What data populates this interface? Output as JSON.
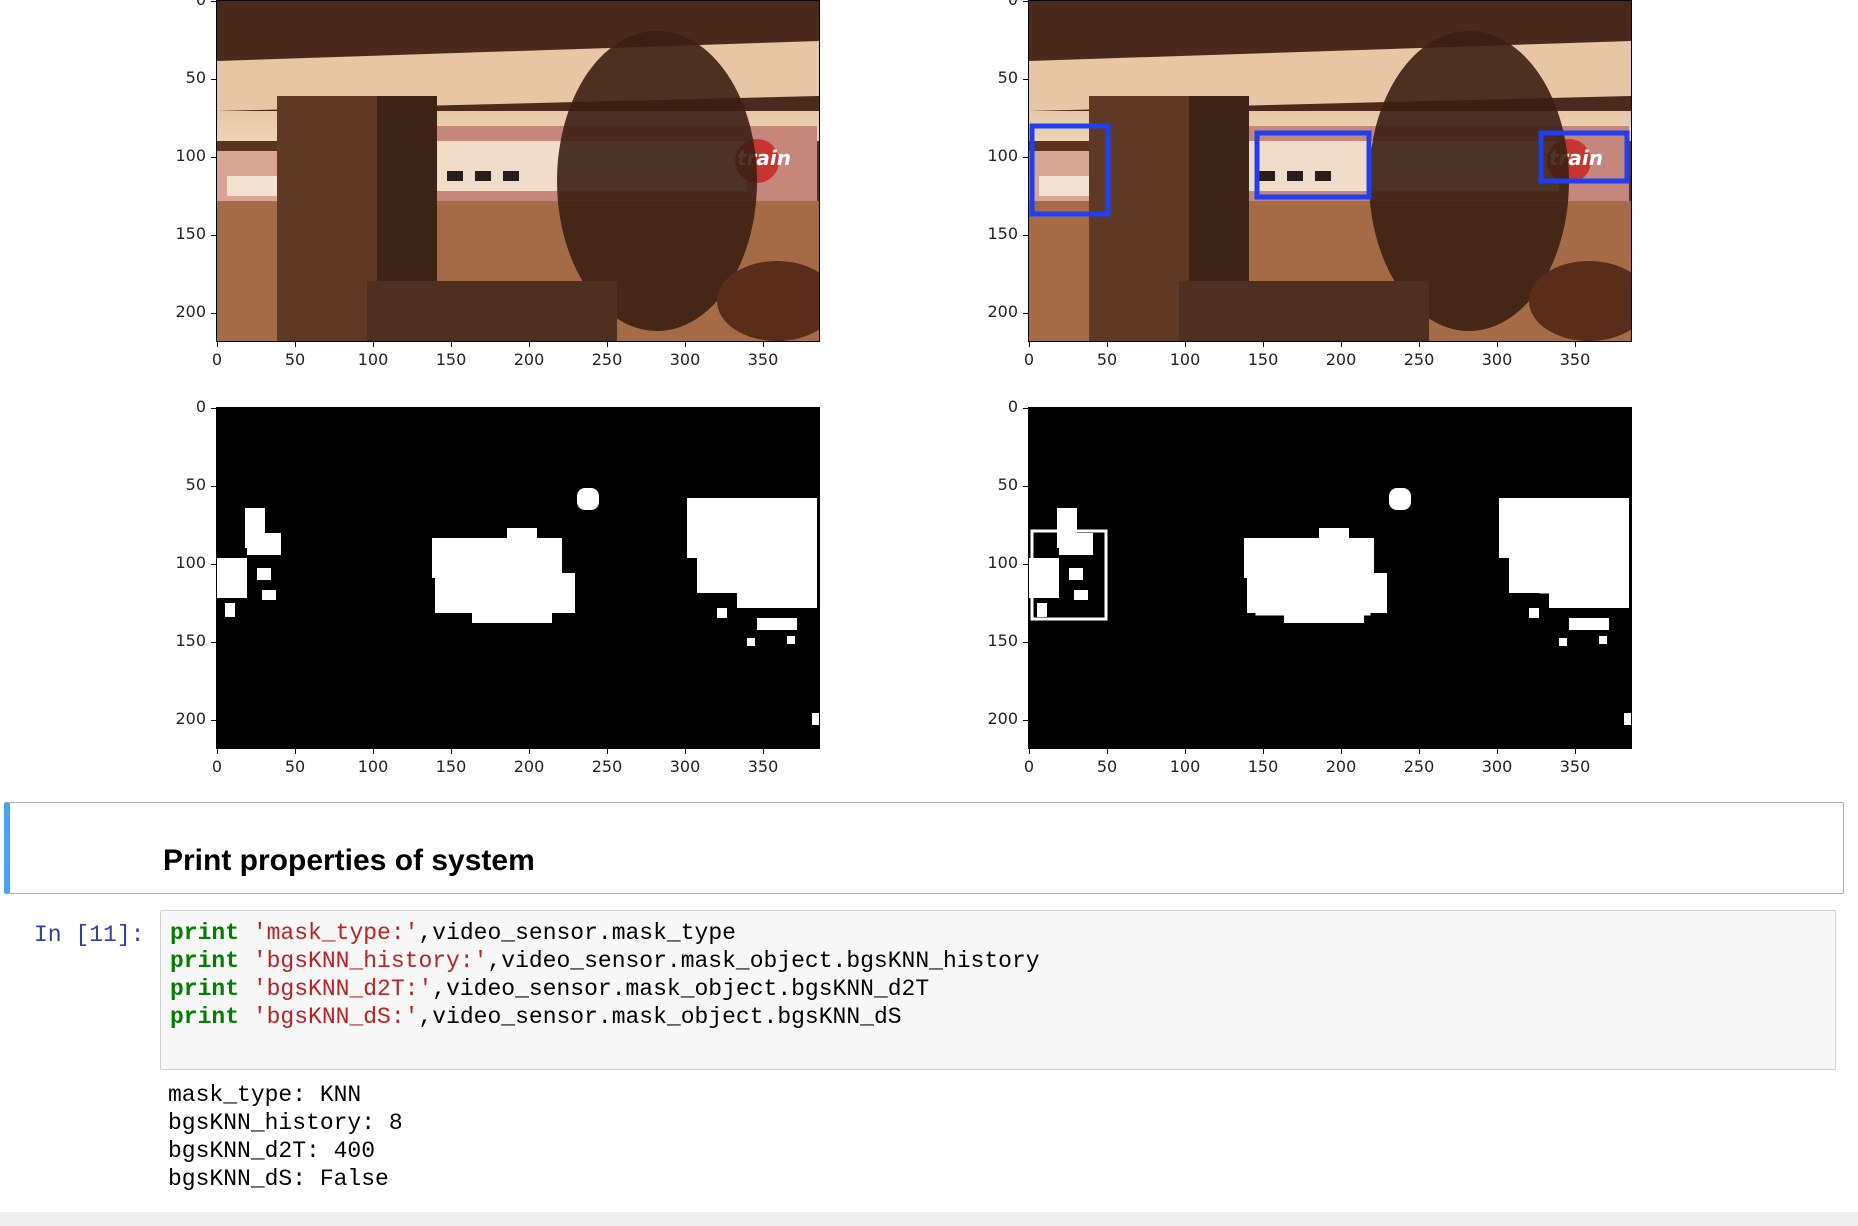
{
  "plots": {
    "y_ticks": [
      "0",
      "50",
      "100",
      "150",
      "200"
    ],
    "x_ticks": [
      "0",
      "50",
      "100",
      "150",
      "200",
      "250",
      "300",
      "350"
    ],
    "photo_text": "train"
  },
  "markdown": {
    "title": "Print properties of system"
  },
  "code_cell": {
    "prompt": "In [11]:",
    "lines": [
      {
        "kw": "print",
        "str": "'mask_type:'",
        "rest": ",video_sensor.mask_type"
      },
      {
        "kw": "print",
        "str": "'bgsKNN_history:'",
        "rest": ",video_sensor.mask_object.bgsKNN_history"
      },
      {
        "kw": "print",
        "str": "'bgsKNN_d2T:'",
        "rest": ",video_sensor.mask_object.bgsKNN_d2T"
      },
      {
        "kw": "print",
        "str": "'bgsKNN_dS:'",
        "rest": ",video_sensor.mask_object.bgsKNN_dS"
      }
    ]
  },
  "output": {
    "lines": [
      "mask_type: KNN",
      "bgsKNN_history: 8",
      "bgsKNN_d2T: 400",
      "bgsKNN_dS: False"
    ]
  },
  "colors": {
    "box_blue": "#1f3ff0",
    "prompt_blue": "#303f9f",
    "keyword_green": "#008000",
    "string_red": "#ba2121",
    "md_border": "#42a5f5"
  }
}
